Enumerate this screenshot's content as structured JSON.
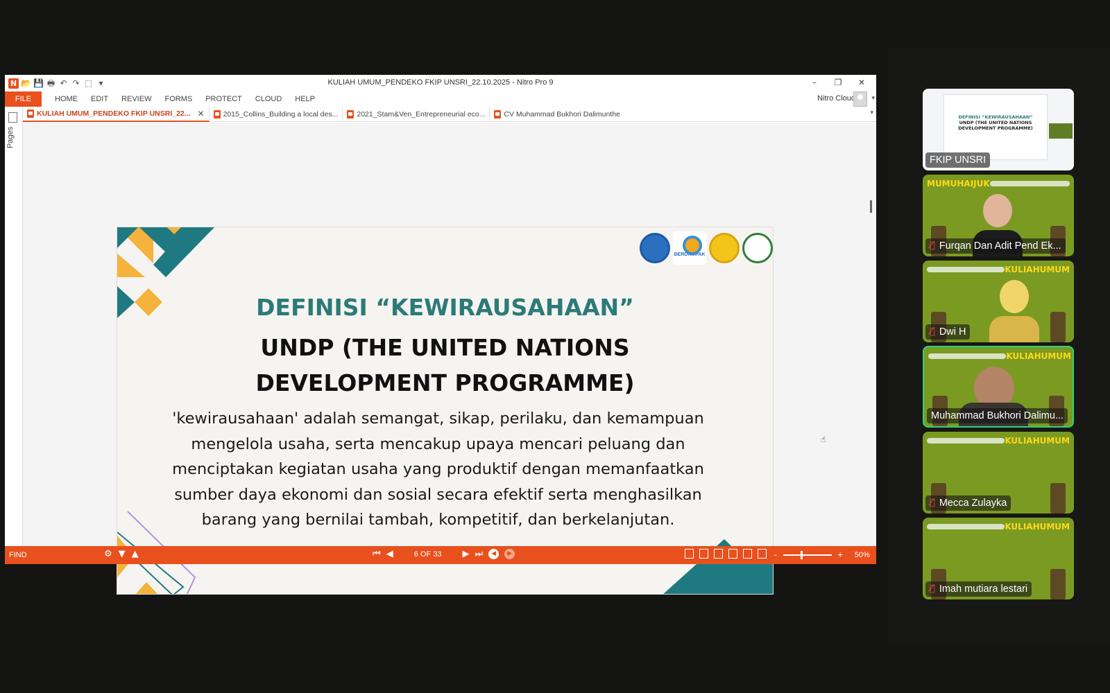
{
  "window": {
    "title": "KULIAH UMUM_PENDEKO FKIP UNSRI_22.10.2025 - Nitro Pro 9",
    "controls": {
      "minimize": "–",
      "restore": "❐",
      "close": "✕"
    }
  },
  "ribbon": {
    "file": "FILE",
    "tabs": [
      "HOME",
      "EDIT",
      "REVIEW",
      "FORMS",
      "PROTECT",
      "CLOUD",
      "HELP"
    ],
    "account": "Nitro Cloud"
  },
  "doc_tabs": [
    {
      "label": "KULIAH UMUM_PENDEKO FKIP UNSRI_22...",
      "active": true,
      "close": "✕"
    },
    {
      "label": "2015_Collins_Building a local des..."
    },
    {
      "label": "2021_Stam&Ven_Entrepreneurial eco..."
    },
    {
      "label": "CV Muhammad Bukhori Dalimunthe"
    }
  ],
  "side_pane": {
    "label": "Pages"
  },
  "slide": {
    "title_line1": "DEFINISI “KEWIRAUSAHAAN”",
    "title_line2": "UNDP (THE UNITED NATIONS",
    "title_line3": "DEVELOPMENT PROGRAMME)",
    "body": "'kewirausahaan' adalah semangat, sikap, perilaku, dan kemampuan mengelola usaha, serta mencakup upaya mencari peluang dan menciptakan kegiatan usaha yang produktif dengan memanfaatkan sumber daya ekonomi dan sosial secara efektif  serta menghasilkan barang yang bernilai tambah, kompetitif, dan berkelanjutan.",
    "logo2_text": "BERDAMPAK",
    "colors": {
      "teal": "#1e7a80",
      "orange": "#f5b23c",
      "title_green": "#2b7b78"
    }
  },
  "statusbar": {
    "find": "FIND",
    "page_display": "6 OF 33",
    "zoom": "50%",
    "zoom_minus": "–",
    "zoom_plus": "+",
    "zoom_level": 0.5
  },
  "participants": [
    {
      "name": "FKIP UNSRI",
      "muted": false,
      "type": "screen"
    },
    {
      "name": "Furqan Dan Adit Pend Ek...",
      "muted": true,
      "banner": "MUMUHAIJUK"
    },
    {
      "name": "Dwi H",
      "muted": true,
      "banner": "KULIAHUMUM"
    },
    {
      "name": "Muhammad Bukhori Dalimu...",
      "muted": false,
      "active": true,
      "banner": "KULIAHUMUM"
    },
    {
      "name": "Mecca Zulayka",
      "muted": true,
      "banner": "KULIAHUMUM"
    },
    {
      "name": "Imah mutiara lestari",
      "muted": true,
      "banner": "KULIAHUMUM"
    }
  ],
  "mini_slide": {
    "line1": "DEFINISI “KEWIRAUSAHAAN”",
    "line2": "UNDP (THE UNITED NATIONS",
    "line3": "DEVELOPMENT PROGRAMME)"
  },
  "icons": {
    "mute": "mic-off-icon",
    "cursor": "hand-cursor-icon"
  }
}
